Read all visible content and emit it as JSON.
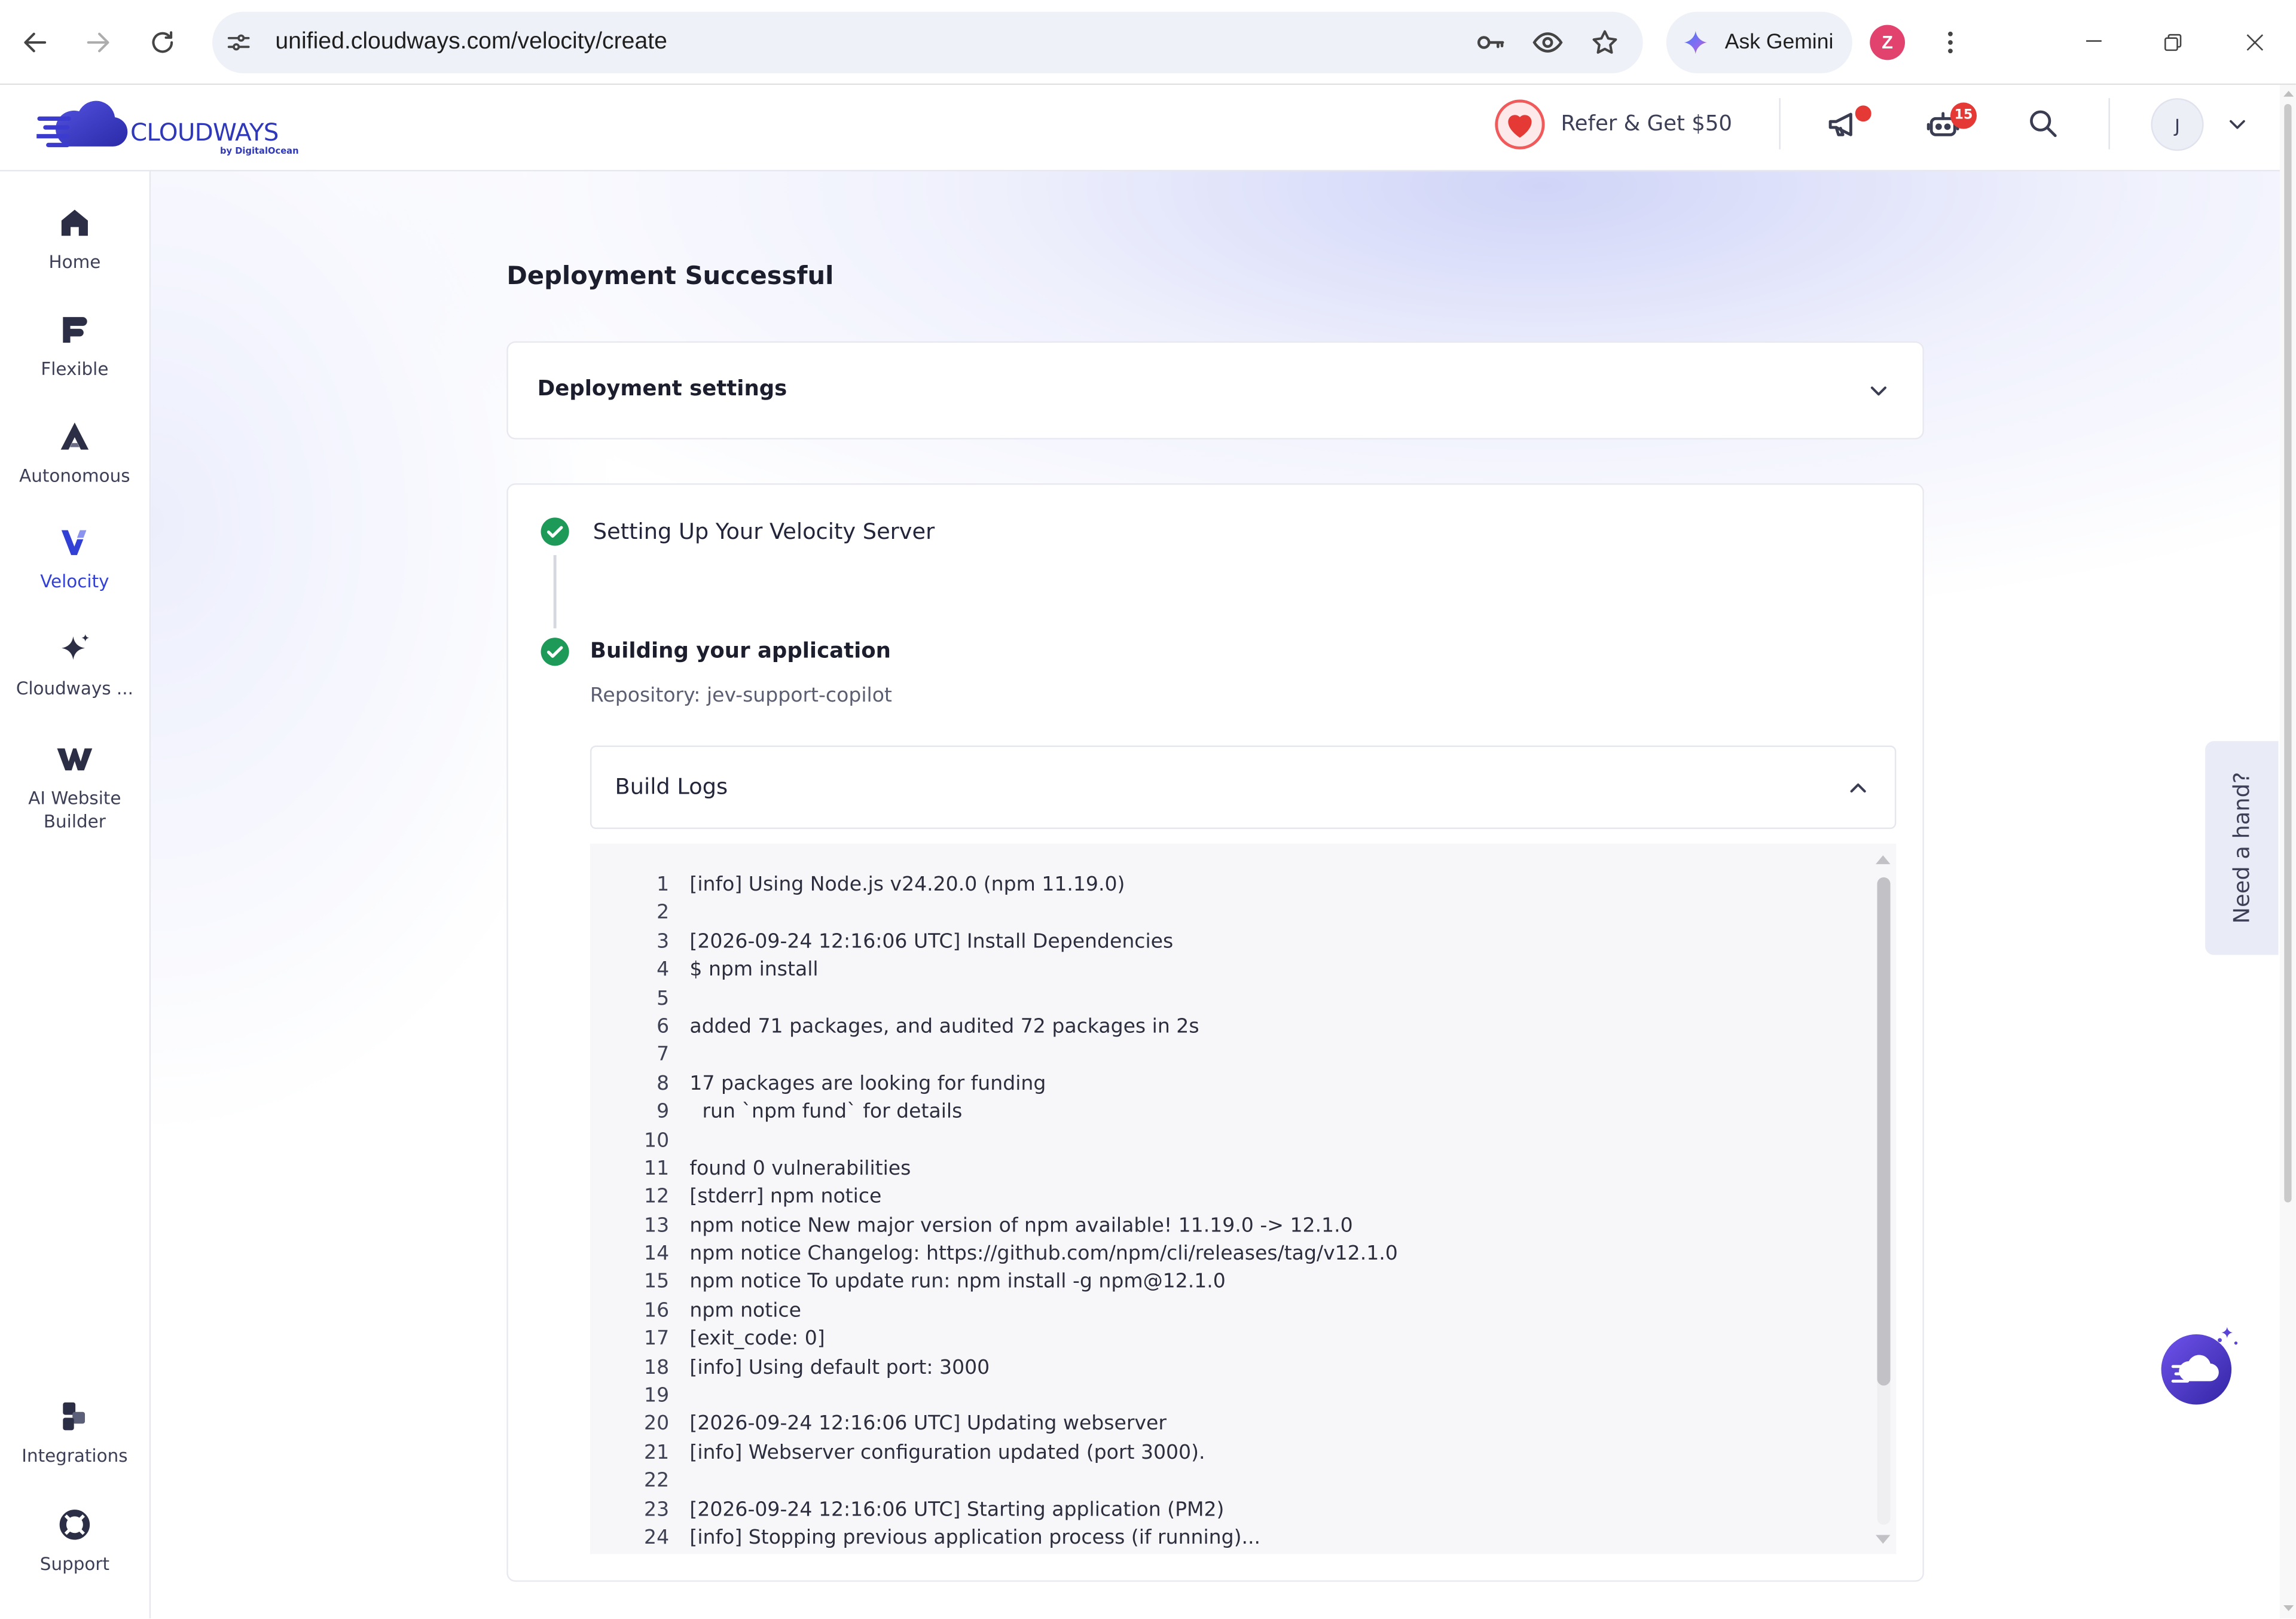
{
  "browser": {
    "url": "unified.cloudways.com/velocity/create",
    "ask_gemini": "Ask Gemini",
    "profile_initial": "Z",
    "icons": [
      "back-arrow-icon",
      "forward-arrow-icon",
      "reload-icon",
      "site-settings-icon",
      "password-key-icon",
      "eye-icon",
      "bookmark-star-icon",
      "gemini-icon",
      "more-vert-icon",
      "minimize-icon",
      "restore-icon",
      "close-icon"
    ]
  },
  "header": {
    "logo_text": "CLOUDWAYS",
    "logo_byline": "by DigitalOcean",
    "refer_label": "Refer & Get $50",
    "bot_badge": "15",
    "avatar_initial": "J",
    "icons": [
      "heart-icon",
      "megaphone-icon",
      "bot-icon",
      "search-icon",
      "chevron-down-icon"
    ]
  },
  "sidebar": {
    "items": [
      {
        "label": "Home",
        "icon": "home-icon"
      },
      {
        "label": "Flexible",
        "icon": "flexible-icon"
      },
      {
        "label": "Autonomous",
        "icon": "autonomous-icon"
      },
      {
        "label": "Velocity",
        "icon": "velocity-icon",
        "active": true
      },
      {
        "label": "Cloudways ...",
        "icon": "sparkle-icon"
      },
      {
        "label": "AI Website Builder",
        "icon": "website-builder-icon"
      }
    ],
    "bottom_items": [
      {
        "label": "Integrations",
        "icon": "integrations-icon"
      },
      {
        "label": "Support",
        "icon": "support-icon"
      }
    ]
  },
  "main": {
    "title": "Deployment Successful",
    "deployment_settings": {
      "label": "Deployment settings",
      "expanded": false
    },
    "steps": [
      {
        "label": "Setting Up Your Velocity Server",
        "icon": "check-circle-icon"
      },
      {
        "label": "Building your application",
        "icon": "check-circle-icon",
        "detail": "Repository: jev-support-copilot"
      }
    ],
    "build_logs": {
      "title": "Build Logs",
      "expanded": true,
      "lines": [
        {
          "n": "1",
          "text": "[info] Using Node.js v24.20.0 (npm 11.19.0)"
        },
        {
          "n": "2",
          "text": ""
        },
        {
          "n": "3",
          "text": "[2026-09-24 12:16:06 UTC] Install Dependencies"
        },
        {
          "n": "4",
          "text": "$ npm install"
        },
        {
          "n": "5",
          "text": ""
        },
        {
          "n": "6",
          "text": "added 71 packages, and audited 72 packages in 2s"
        },
        {
          "n": "7",
          "text": ""
        },
        {
          "n": "8",
          "text": "17 packages are looking for funding"
        },
        {
          "n": "9",
          "text": "  run `npm fund` for details"
        },
        {
          "n": "10",
          "text": ""
        },
        {
          "n": "11",
          "text": "found 0 vulnerabilities"
        },
        {
          "n": "12",
          "text": "[stderr] npm notice"
        },
        {
          "n": "13",
          "text": "npm notice New major version of npm available! 11.19.0 -> 12.1.0"
        },
        {
          "n": "14",
          "text": "npm notice Changelog: https://github.com/npm/cli/releases/tag/v12.1.0"
        },
        {
          "n": "15",
          "text": "npm notice To update run: npm install -g npm@12.1.0"
        },
        {
          "n": "16",
          "text": "npm notice"
        },
        {
          "n": "17",
          "text": "[exit_code: 0]"
        },
        {
          "n": "18",
          "text": "[info] Using default port: 3000"
        },
        {
          "n": "19",
          "text": ""
        },
        {
          "n": "20",
          "text": "[2026-09-24 12:16:06 UTC] Updating webserver"
        },
        {
          "n": "21",
          "text": "[info] Webserver configuration updated (port 3000)."
        },
        {
          "n": "22",
          "text": ""
        },
        {
          "n": "23",
          "text": "[2026-09-24 12:16:06 UTC] Starting application (PM2)"
        },
        {
          "n": "24",
          "text": "[info] Stopping previous application process (if running)..."
        }
      ]
    }
  },
  "help_tab": {
    "label": "Need a hand?"
  },
  "assistant_button": {
    "icon": "cloudways-bot-icon"
  },
  "colors": {
    "brand": "#2f38b8",
    "active_nav": "#3340d6",
    "success": "#1d9a58",
    "notification": "#e53935",
    "sidebar_text": "#3c3f55",
    "log_background": "#f7f7f9"
  }
}
